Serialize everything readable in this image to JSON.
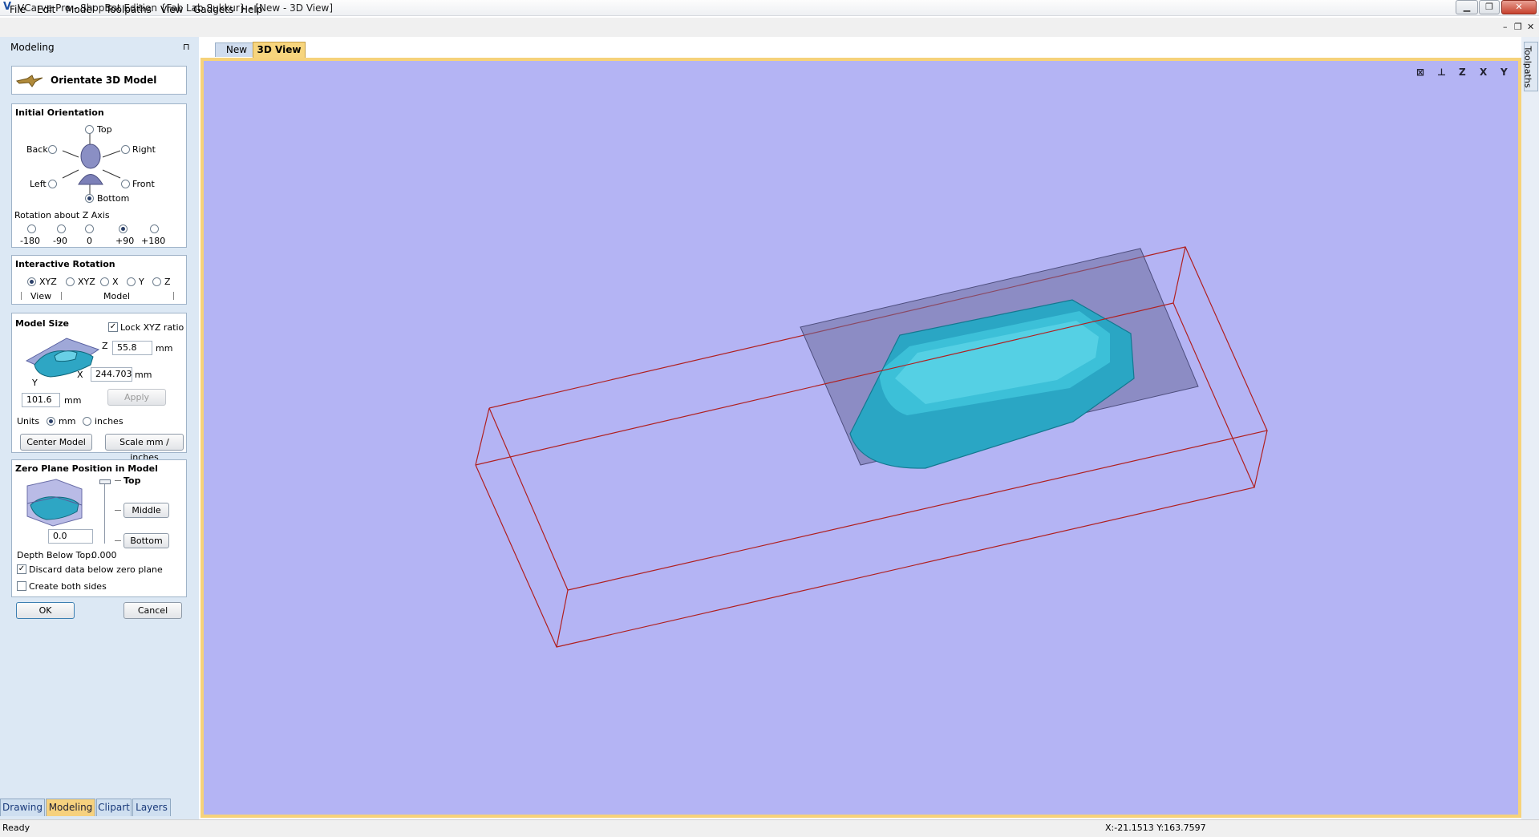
{
  "window": {
    "title": "VCarve Pro - ShopBot Edition {Fab Lab Sukkur} - [New - 3D View]",
    "min_glyph": "▁",
    "max_glyph": "❐",
    "close_glyph": "✕"
  },
  "menu": [
    "File",
    "Edit",
    "Model",
    "Toolpaths",
    "View",
    "Gadgets",
    "Help"
  ],
  "mdi_controls": {
    "min": "–",
    "restore": "❐",
    "close": "✕"
  },
  "panel": {
    "title": "Modeling",
    "pin": "⊓",
    "header_title": "Orientate 3D Model",
    "initial_orientation": {
      "title": "Initial Orientation",
      "top": "Top",
      "back": "Back",
      "right": "Right",
      "left": "Left",
      "front": "Front",
      "bottom": "Bottom",
      "selected": "Bottom"
    },
    "rotation_z": {
      "label": "Rotation about Z Axis",
      "options": [
        "-180",
        "-90",
        "0",
        "+90",
        "+180"
      ],
      "selected": "+90"
    },
    "interactive_rotation": {
      "title": "Interactive Rotation",
      "options": [
        "XYZ",
        "XYZ",
        "X",
        "Y",
        "Z"
      ],
      "selected": 0,
      "group_view": "View",
      "group_model": "Model"
    },
    "model_size": {
      "title": "Model Size",
      "lock_label": "Lock XYZ ratio",
      "lock_checked": true,
      "z_label": "Z",
      "z_value": "55.8",
      "x_label": "X",
      "x_value": "244.703",
      "y_label": "Y",
      "y_value": "101.6",
      "unit": "mm",
      "apply": "Apply",
      "units_label": "Units",
      "unit_mm": "mm",
      "unit_inches": "inches",
      "center_model": "Center Model",
      "scale": "Scale mm / inches"
    },
    "zero_plane": {
      "title": "Zero Plane Position in Model",
      "top": "Top",
      "middle": "Middle",
      "bottom": "Bottom",
      "value": "0.0",
      "depth_label": "Depth Below Top:",
      "depth_value": "0.000",
      "discard_label": "Discard data below zero plane",
      "discard_checked": true,
      "both_sides_label": "Create both sides",
      "both_sides_checked": false
    },
    "ok": "OK",
    "cancel": "Cancel"
  },
  "bottom_tabs": [
    "Drawing",
    "Modeling",
    "Clipart",
    "Layers"
  ],
  "active_bottom_tab": "Modeling",
  "doc_tabs": [
    "New",
    "3D View"
  ],
  "active_doc_tab": "3D View",
  "side_tab": "Toolpaths",
  "view_icons": [
    "⊠",
    "⊥",
    "Z",
    "X",
    "Y"
  ],
  "status": {
    "text": "Ready",
    "coords": "X:-21.1513 Y:163.7597"
  },
  "colors": {
    "viewport_bg": "#b4b4f4",
    "model": "#2aa6c4",
    "zero_plane": "#6c6c9c",
    "bounding_box": "#b02020",
    "active_tab": "#f6d17e",
    "panel_bg": "#dce8f4"
  }
}
